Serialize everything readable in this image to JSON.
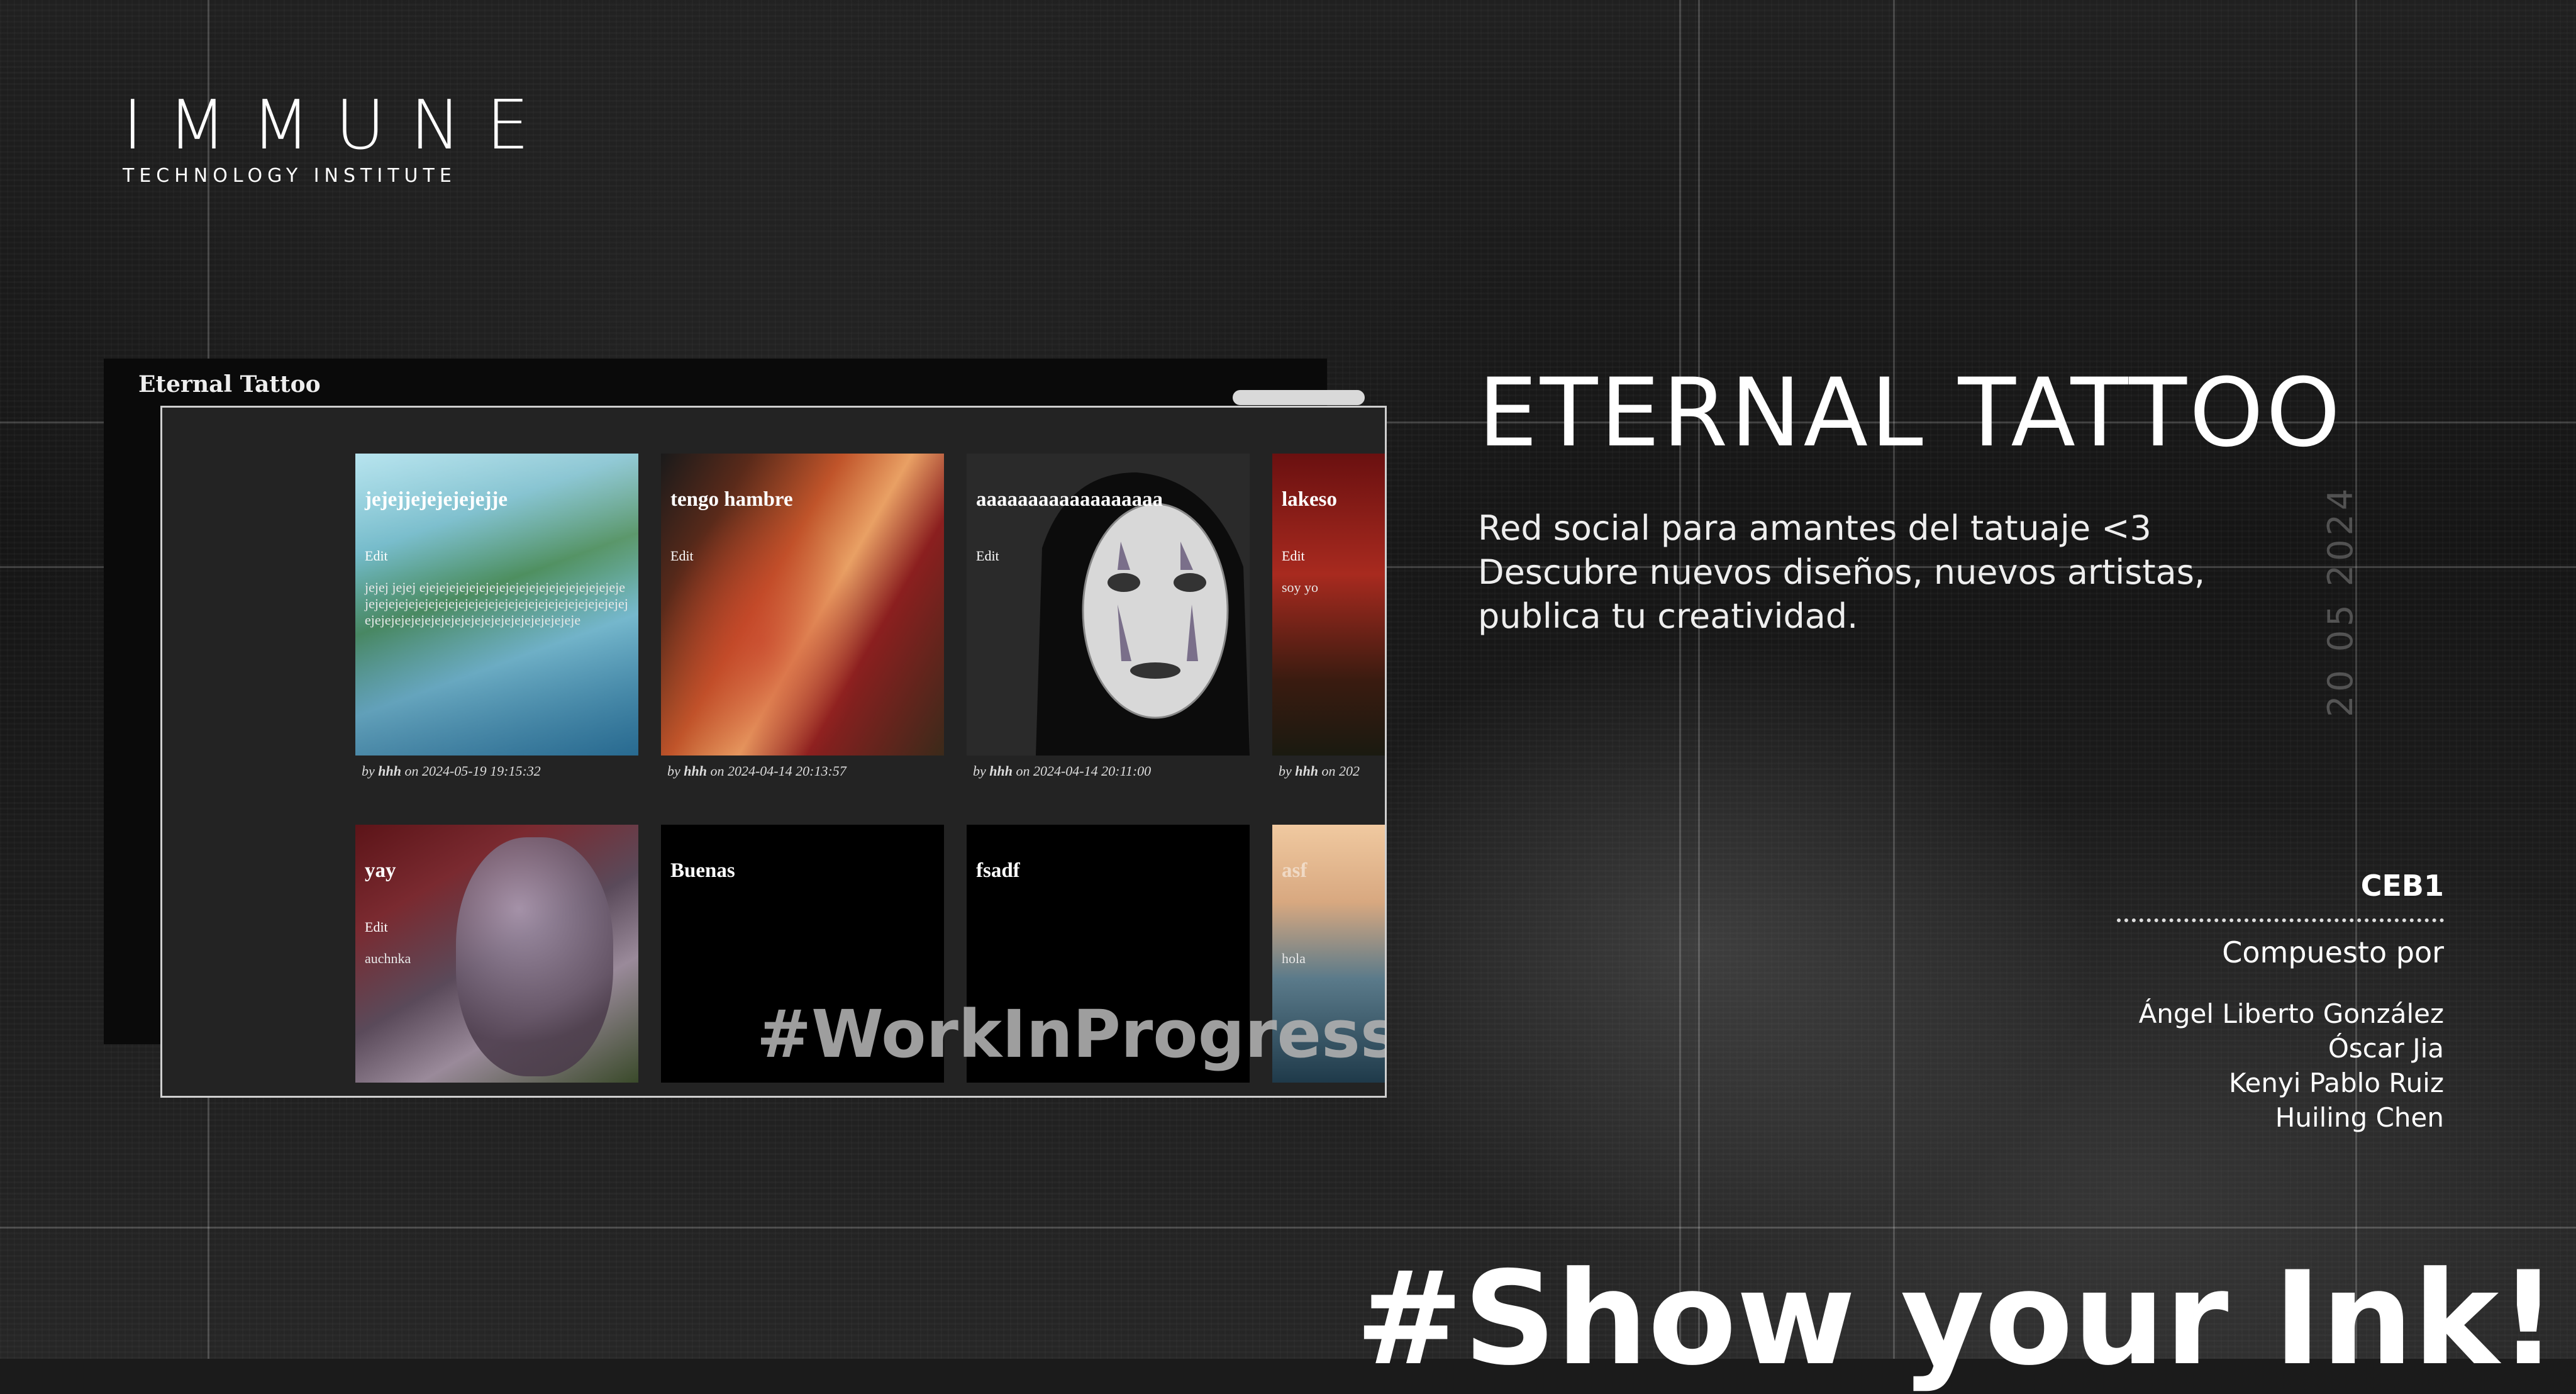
{
  "logo": {
    "main": "IMMUNE",
    "sub": "TECHNOLOGY INSTITUTE"
  },
  "screenshot": {
    "back_title": "Eternal Tattoo",
    "cards": [
      {
        "title": "jejejjejejejejejje",
        "edit": "Edit",
        "desc": "jejej jejej ejejejejejejejejejejejejejejejejejejejejejejejejejejejejejejejejejejejejejejejejejejejejejejejejejejejejejejejejejejejejejejejejejejejeje",
        "author": "hhh",
        "date": "2024-05-19 19:15:32"
      },
      {
        "title": "tengo hambre",
        "edit": "Edit",
        "desc": "",
        "author": "hhh",
        "date": "2024-04-14 20:13:57"
      },
      {
        "title": "aaaaaaaaaaaaaaaaaa",
        "edit": "Edit",
        "desc": "",
        "author": "hhh",
        "date": "2024-04-14 20:11:00"
      },
      {
        "title": "lakeso",
        "edit": "Edit",
        "desc": "soy yo",
        "author": "hhh",
        "date": "202"
      },
      {
        "title": "yay",
        "edit": "Edit",
        "desc": "auchnka",
        "author": "",
        "date": ""
      },
      {
        "title": "Buenas",
        "edit": "",
        "desc": "",
        "author": "",
        "date": ""
      },
      {
        "title": "fsadf",
        "edit": "",
        "desc": "",
        "author": "",
        "date": ""
      },
      {
        "title": "asf",
        "edit": "",
        "desc": "hola",
        "author": "",
        "date": ""
      }
    ],
    "meta_by": "by",
    "meta_on": "on",
    "overlay": "#WorkInProgress"
  },
  "project": {
    "title": "ETERNAL TATTOO",
    "subtitle_lines": [
      "Red social para amantes del tatuaje <3",
      "Descubre nuevos diseños, nuevos artistas,",
      "publica tu creatividad."
    ],
    "date": "20 05 2024"
  },
  "team": {
    "code": "CEB1",
    "by": "Compuesto por",
    "members": [
      "Ángel Liberto González",
      "Óscar Jia",
      "Kenyi Pablo Ruiz",
      "Huiling Chen"
    ]
  },
  "slogan": "#Show your Ink!"
}
